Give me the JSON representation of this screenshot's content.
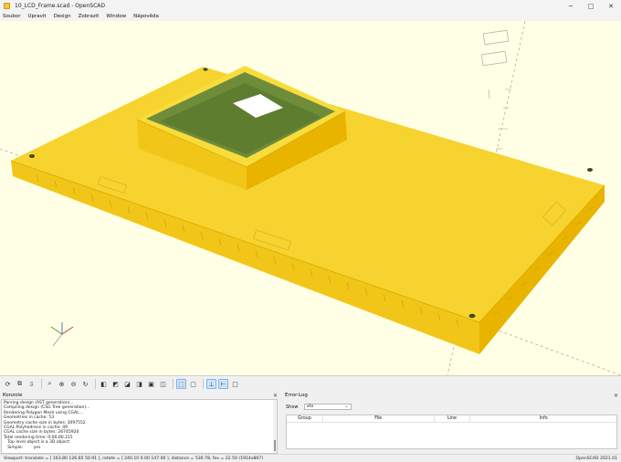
{
  "window": {
    "title": "10_LCD_Frame.scad - OpenSCAD",
    "minimize": "─",
    "maximize": "□",
    "close": "✕"
  },
  "menu": [
    "Soubor",
    "Upravit",
    "Design",
    "Zobrazit",
    "Window",
    "Nápověda"
  ],
  "colors": {
    "model_top": "#f6d32e",
    "model_front": "#f2c618",
    "model_side": "#e8b400",
    "frame_inner": "#6e8c3a",
    "viewport_bg": "#ffffe5"
  },
  "toolbar_icons": [
    "preview-icon",
    "render-icon",
    "stl-export-icon",
    "zoom-all-icon",
    "zoom-in-icon",
    "zoom-out-icon",
    "reset-view-icon",
    "view-right-icon",
    "view-top-icon",
    "view-bottom-icon",
    "view-left-icon",
    "view-front-icon",
    "view-back-icon",
    "perspective-icon",
    "orthogonal-icon",
    "show-axes-icon",
    "show-scale-icon",
    "show-edges-icon"
  ],
  "console": {
    "title": "Konzole",
    "close": "✕",
    "lines": [
      "Parsing design (AST generation)...",
      "Compiling design (CSG Tree generation)...",
      "Rendering Polygon Mesh using CGAL...",
      "Geometries in cache: 53",
      "Geometry cache size in bytes: 3097552",
      "CGAL Polyhedrons in cache: 49",
      "CGAL cache size in bytes: 26745920",
      "Total rendering time: 0:00:00.215",
      "   Top level object is a 3D object:",
      "   Simple:        yes"
    ]
  },
  "error_log": {
    "title": "Error-Log",
    "close": "✕",
    "show_label": "Show",
    "show_value": "vše",
    "columns": [
      "Group",
      "File",
      "Line",
      "Info"
    ]
  },
  "status": {
    "viewport": "Viewport: translate = [ 163.80 126.65 50.91 ], rotate = [ 240.10 0.00 147.00 ], distance = 530.78, fov = 22.50 (1914x867)",
    "version": "OpenSCAD 2021.01"
  }
}
